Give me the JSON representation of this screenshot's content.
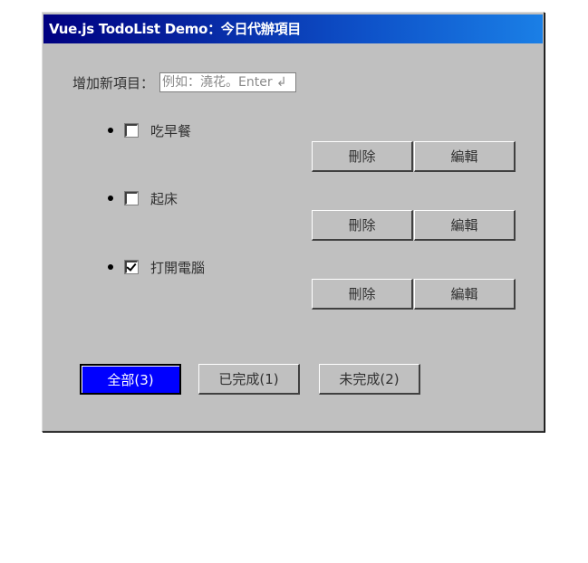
{
  "window": {
    "title": "Vue.js TodoList Demo：今日代辦項目"
  },
  "add": {
    "label": "增加新項目：",
    "placeholder": "例如：澆花。Enter ↲",
    "value": ""
  },
  "todos": [
    {
      "text": "吃早餐",
      "done": false
    },
    {
      "text": "起床",
      "done": false
    },
    {
      "text": "打開電腦",
      "done": true
    }
  ],
  "actions": {
    "delete_label": "刪除",
    "edit_label": "編輯"
  },
  "filters": {
    "all": "全部(3)",
    "completed": "已完成(1)",
    "incomplete": "未完成(2)",
    "active": "all"
  },
  "colors": {
    "window_bg": "#c0c0c0",
    "titlebar_start": "#000080",
    "titlebar_end": "#1a7fe6",
    "active_filter": "#0000ff"
  }
}
